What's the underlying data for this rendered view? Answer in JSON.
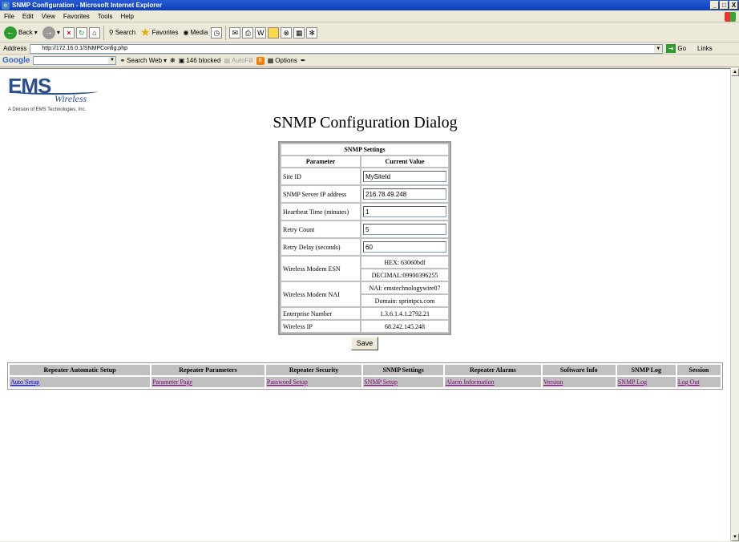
{
  "window": {
    "title": "SNMP Configuration - Microsoft Internet Explorer",
    "controls": [
      "_",
      "□",
      "X"
    ]
  },
  "menu": [
    "File",
    "Edit",
    "View",
    "Favorites",
    "Tools",
    "Help"
  ],
  "toolbar": {
    "back": "Back",
    "search": "Search",
    "favorites": "Favorites",
    "media": "Media"
  },
  "address": {
    "label": "Address",
    "url": "http://172.16.0.1/SNMPConfig.php",
    "go": "Go",
    "links": "Links"
  },
  "google": {
    "logo": "Google",
    "search_web": "Search Web",
    "blocked": "146 blocked",
    "autofill": "AutoFill",
    "options": "Options"
  },
  "page": {
    "logo_text": "EMS",
    "logo_sub": "Wireless",
    "division": "A Division of EMS Technologies, Inc.",
    "heading": "SNMP Configuration Dialog",
    "settings_title": "SNMP Settings",
    "col_param": "Parameter",
    "col_value": "Current Value",
    "rows": {
      "site_id": {
        "label": "Site ID",
        "value": "MySiteId"
      },
      "server_ip": {
        "label": "SNMP Server IP address",
        "value": "216.78.49.248"
      },
      "heartbeat": {
        "label": "Heartbeat Time (minutes)",
        "value": "1"
      },
      "retry_count": {
        "label": "Retry Count",
        "value": "5"
      },
      "retry_delay": {
        "label": "Retry Delay (seconds)",
        "value": "60"
      },
      "esn": {
        "label": "Wireless Modem ESN",
        "hex": "HEX: 63060bdf",
        "decimal": "DECIMAL:09900396255"
      },
      "nai": {
        "label": "Wireless Modem NAI",
        "nai": "NAI: emstechnologywire07",
        "domain": "Domain: sprintpcs.com"
      },
      "enterprise": {
        "label": "Enterprise Number",
        "value": "1.3.6.1.4.1.2792.21"
      },
      "wireless_ip": {
        "label": "Wireless IP",
        "value": "68.242.145.248"
      }
    },
    "save_label": "Save"
  },
  "nav": {
    "headers": [
      "Repeater Automatic Setup",
      "Repeater Parameters",
      "Repeater Security",
      "SNMP Settings",
      "Repeater Alarms",
      "Software Info",
      "SNMP Log",
      "Session"
    ],
    "links": [
      "Auto Setup",
      "Parameter Page",
      "Password Setup",
      "SNMP Setup",
      "Alarm Information",
      "Version",
      "SNMP Log",
      "Log Out"
    ]
  }
}
